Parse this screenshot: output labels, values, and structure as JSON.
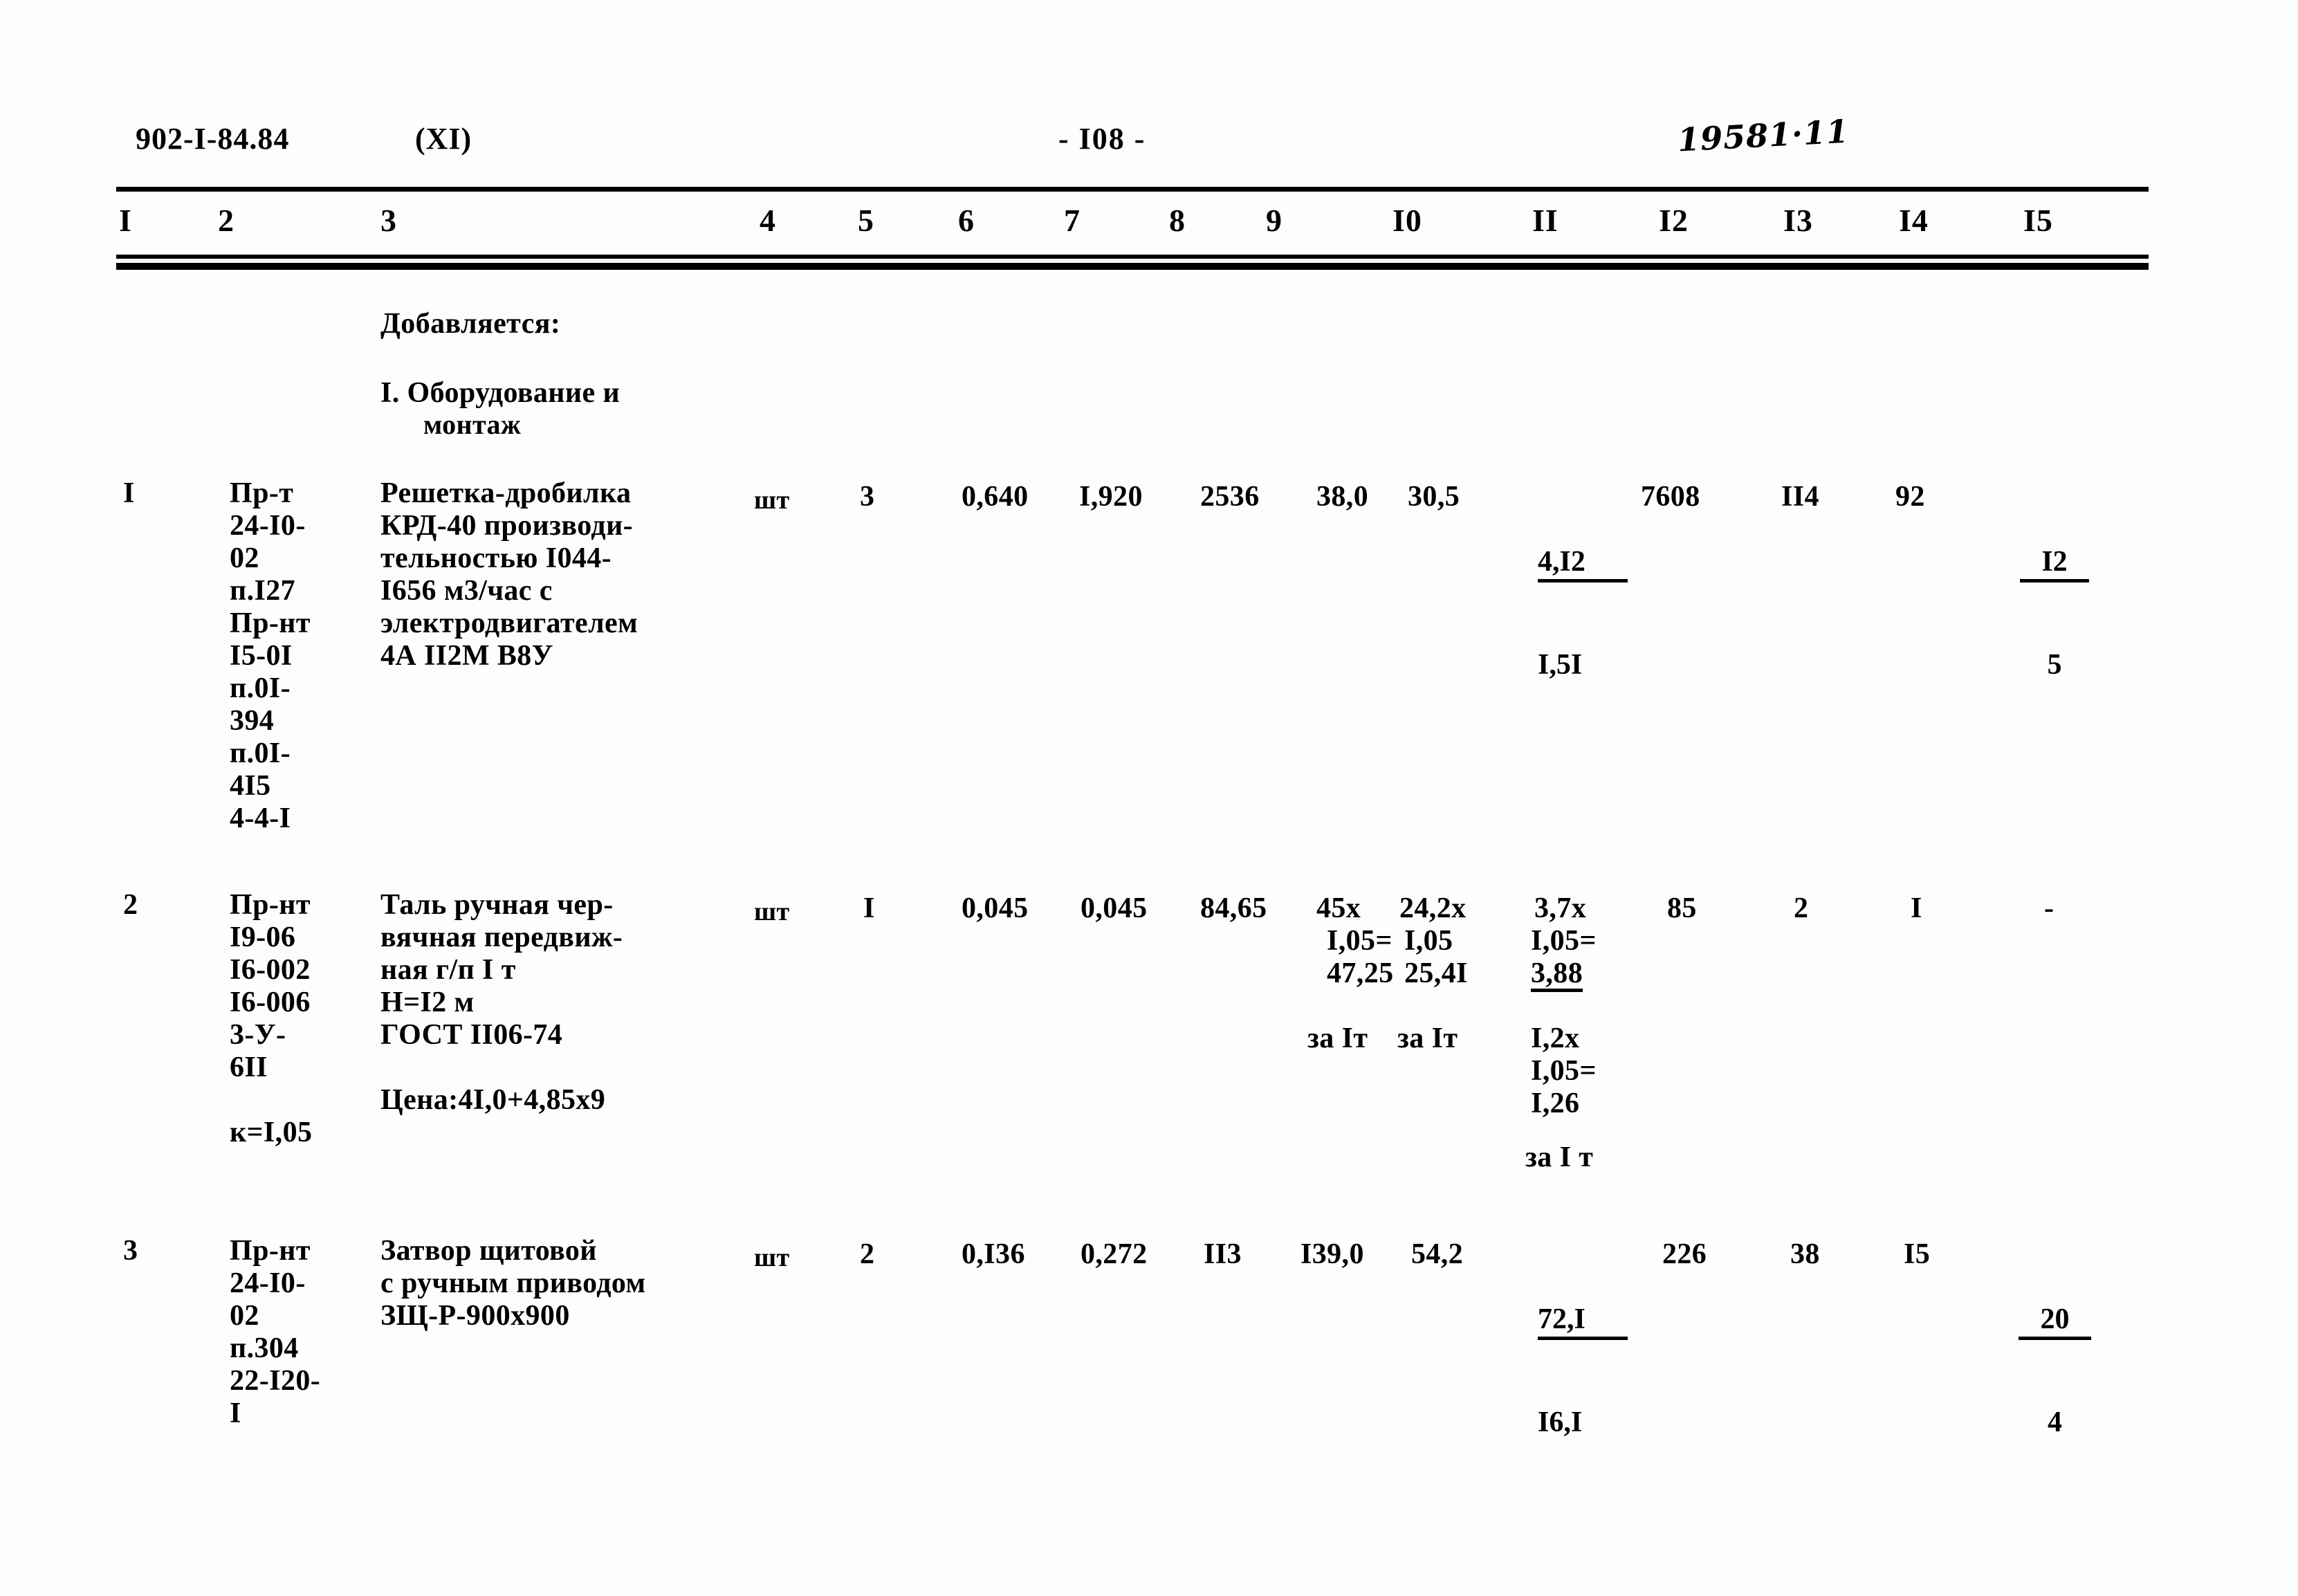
{
  "header": {
    "doc_code": "902-I-84.84",
    "volume": "(XI)",
    "page_number": "- I08 -",
    "stamp": "19581·11"
  },
  "table": {
    "column_headers": [
      "I",
      "2",
      "3",
      "4",
      "5",
      "6",
      "7",
      "8",
      "9",
      "I0",
      "II",
      "I2",
      "I3",
      "I4",
      "I5"
    ],
    "intro": {
      "line1": "Добавляется:",
      "line2": "I. Оборудование и",
      "line3": "монтаж"
    },
    "rows": [
      {
        "num": "I",
        "code": "Пр-т\n24-I0-\n02\nп.I27\nПр-нт\nI5-0I\nп.0I-\n394\nп.0I-\n4I5\n4-4-I",
        "description": "Решетка-дробилка\nКРД-40 производи-\nтельностью I044-\nI656 м3/час с\nэлектродвигателем\n4А II2М В8У",
        "unit": "шт",
        "qty": "3",
        "c6": "0,640",
        "c7": "I,920",
        "c8": "2536",
        "c9": "38,0",
        "c10": "30,5",
        "c11_num": "4,I2",
        "c11_den": "I,5I",
        "c12": "7608",
        "c13": "II4",
        "c14": "92",
        "c15_num": "I2",
        "c15_den": "5"
      },
      {
        "num": "2",
        "code": "Пр-нт\nI9-06\nI6-002\nI6-006\n3-У-\n6II\n\nк=I,05",
        "description": "Таль ручная чер-\nвячная передвиж-\nная г/п I т\nН=I2 м\nГОСТ II06-74\n\nЦена:4I,0+4,85х9",
        "unit": "шт",
        "qty": "I",
        "c6": "0,045",
        "c7": "0,045",
        "c8": "84,65",
        "c9_l1": "45х",
        "c9_l2": "I,05=",
        "c9_l3": "47,25",
        "c9_l4": "за Iт",
        "c10_l1": "24,2х",
        "c10_l2": "I,05",
        "c10_l3": "25,4I",
        "c10_l4": "за Iт",
        "c11_l1": "3,7х",
        "c11_l2": "I,05=",
        "c11_l3": "3,88",
        "c11_l4": "I,2х",
        "c11_l5": "I,05=",
        "c11_l6": "I,26",
        "c11_l7": "за I т",
        "c12": "85",
        "c13": "2",
        "c14": "I",
        "c15": "-"
      },
      {
        "num": "3",
        "code": "Пр-нт\n24-I0-\n02\nп.304\n22-I20-\nI",
        "description": "Затвор щитовой\nс ручным приводом\nЗЩ-Р-900х900",
        "unit": "шт",
        "qty": "2",
        "c6": "0,I36",
        "c7": "0,272",
        "c8": "II3",
        "c9": "I39,0",
        "c10": "54,2",
        "c11_num": "72,I",
        "c11_den": "I6,I",
        "c12": "226",
        "c13": "38",
        "c14": "I5",
        "c15_num": "20",
        "c15_den": "4"
      }
    ]
  }
}
